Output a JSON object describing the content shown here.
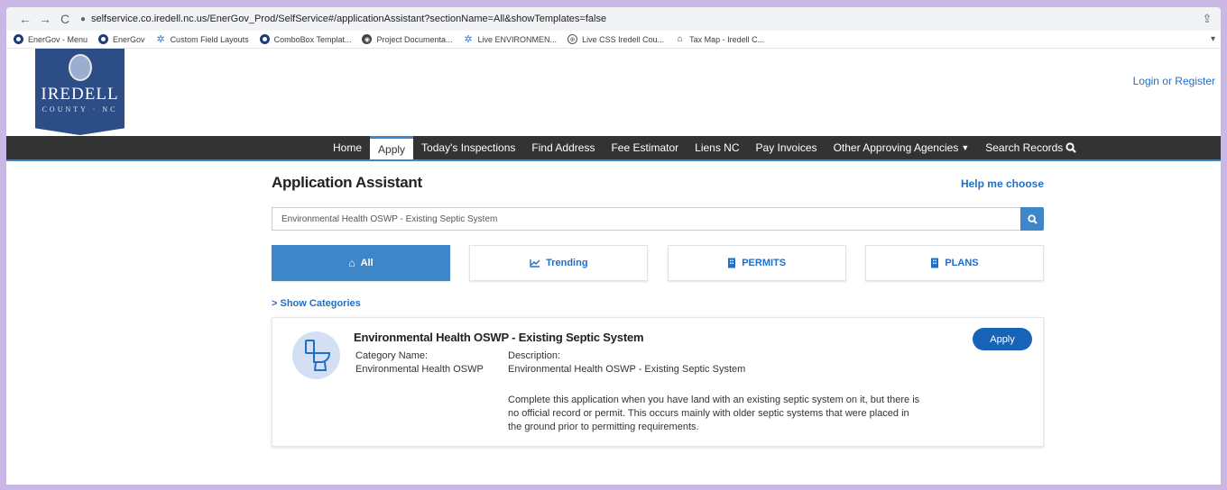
{
  "browser": {
    "url": "selfservice.co.iredell.nc.us/EnerGov_Prod/SelfService#/applicationAssistant?sectionName=All&showTemplates=false",
    "bookmarks": [
      {
        "icon": "ring-icon",
        "label": "EnerGov - Menu"
      },
      {
        "icon": "ring-icon",
        "label": "EnerGov"
      },
      {
        "icon": "leaf-icon",
        "label": "Custom Field Layouts"
      },
      {
        "icon": "ring-icon",
        "label": "ComboBox Templat..."
      },
      {
        "icon": "chrome-icon",
        "label": "Project Documenta..."
      },
      {
        "icon": "leaf-icon",
        "label": "Live ENVIRONMEN..."
      },
      {
        "icon": "globe-icon",
        "label": "Live CSS Iredell Cou..."
      },
      {
        "icon": "house-icon",
        "label": "Tax Map - Iredell C..."
      }
    ]
  },
  "header": {
    "logo_title": "IREDELL",
    "logo_subtitle": "COUNTY · NC",
    "login_label": "Login or Register"
  },
  "nav": {
    "items": [
      "Home",
      "Apply",
      "Today's Inspections",
      "Find Address",
      "Fee Estimator",
      "Liens NC",
      "Pay Invoices",
      "Other Approving Agencies",
      "Search Records"
    ],
    "active": "Apply"
  },
  "main": {
    "title": "Application Assistant",
    "help_label": "Help me choose",
    "search_value": "Environmental Health OSWP - Existing Septic System",
    "tabs": [
      {
        "label": "All",
        "icon": "home-icon",
        "active": true
      },
      {
        "label": "Trending",
        "icon": "chart-icon",
        "active": false
      },
      {
        "label": "PERMITS",
        "icon": "building-icon",
        "active": false
      },
      {
        "label": "PLANS",
        "icon": "building-icon",
        "active": false
      }
    ],
    "show_categories": "Show Categories",
    "result": {
      "title": "Environmental Health OSWP - Existing Septic System",
      "category_label": "Category Name:",
      "category_value": "Environmental Health OSWP",
      "description_label": "Description:",
      "description_value": "Environmental Health OSWP - Existing Septic System",
      "description_long": "Complete this application when you have land with an existing septic system on it, but there is no official record or permit. This occurs mainly with older septic systems that were placed in the ground prior to permitting requirements.",
      "apply_label": "Apply",
      "icon": "toilet-icon"
    }
  },
  "colors": {
    "brand": "#2c4d86",
    "accent": "#3d87c9",
    "link": "#1f6fc5",
    "navbar": "#333333",
    "apply_button": "#1763b8"
  }
}
